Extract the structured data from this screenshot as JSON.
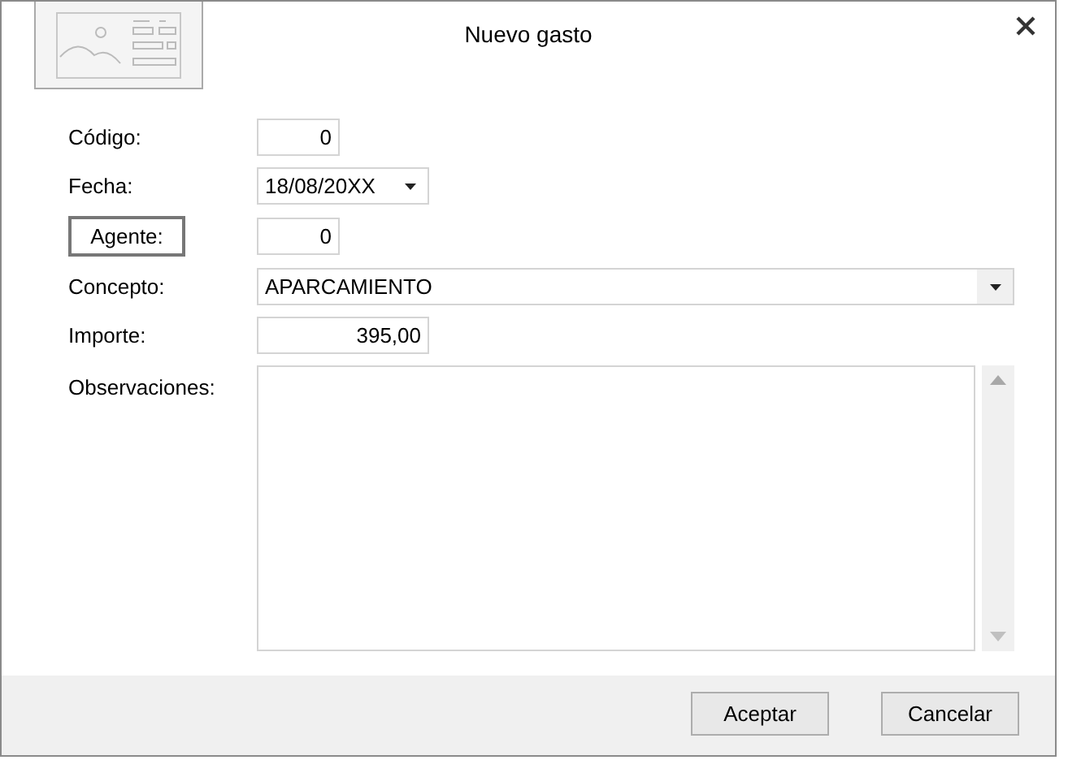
{
  "window": {
    "title": "Nuevo gasto"
  },
  "fields": [
    {
      "label": "Código:",
      "label_button": false,
      "kind": "number",
      "value": "0"
    },
    {
      "label": "Fecha:",
      "label_button": false,
      "kind": "date",
      "value": "18/08/20XX"
    },
    {
      "label": "Agente:",
      "label_button": true,
      "kind": "number",
      "value": "0"
    },
    {
      "label": "Concepto:",
      "label_button": false,
      "kind": "combo",
      "value": "APARCAMIENTO"
    },
    {
      "label": "Importe:",
      "label_button": false,
      "kind": "amount",
      "value": "395,00"
    },
    {
      "label": "Observaciones:",
      "label_button": false,
      "kind": "textarea"
    }
  ],
  "buttons": [
    "Aceptar",
    "Cancelar"
  ]
}
